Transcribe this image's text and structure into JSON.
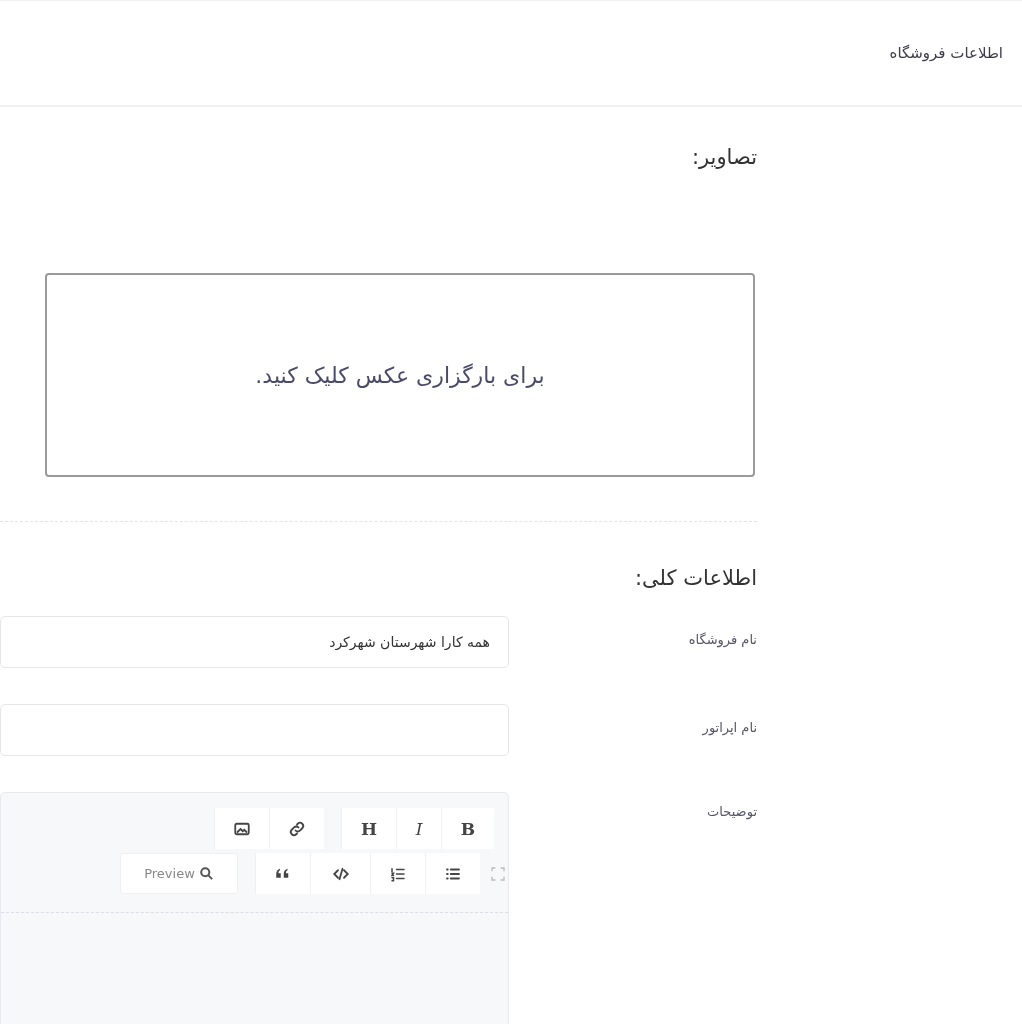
{
  "header": {
    "title": "اطلاعات فروشگاه"
  },
  "images_section": {
    "title": "تصاویر:",
    "upload_prompt": "برای بارگزاری عکس کلیک کنید."
  },
  "general_section": {
    "title": "اطلاعات کلی:",
    "fields": [
      {
        "label": "نام فروشگاه",
        "value": "همه کارا شهرستان شهرکرد",
        "kind": "text"
      },
      {
        "label": "نام اپراتور",
        "kind": "text"
      },
      {
        "label": "توضیحات",
        "kind": "editor"
      }
    ]
  },
  "editor": {
    "toolbar_rows": [
      [
        {
          "kind": "bold",
          "text": "B"
        },
        {
          "kind": "italic",
          "text": "I"
        },
        {
          "kind": "heading",
          "text": "H"
        },
        {
          "kind": "gap"
        },
        {
          "kind": "link"
        },
        {
          "kind": "image"
        }
      ],
      [
        {
          "kind": "fullscreen"
        },
        {
          "kind": "unordered-list"
        },
        {
          "kind": "ordered-list"
        },
        {
          "kind": "code"
        },
        {
          "kind": "quote"
        },
        {
          "kind": "gap"
        },
        {
          "kind": "preview",
          "text": "Preview"
        }
      ]
    ]
  }
}
